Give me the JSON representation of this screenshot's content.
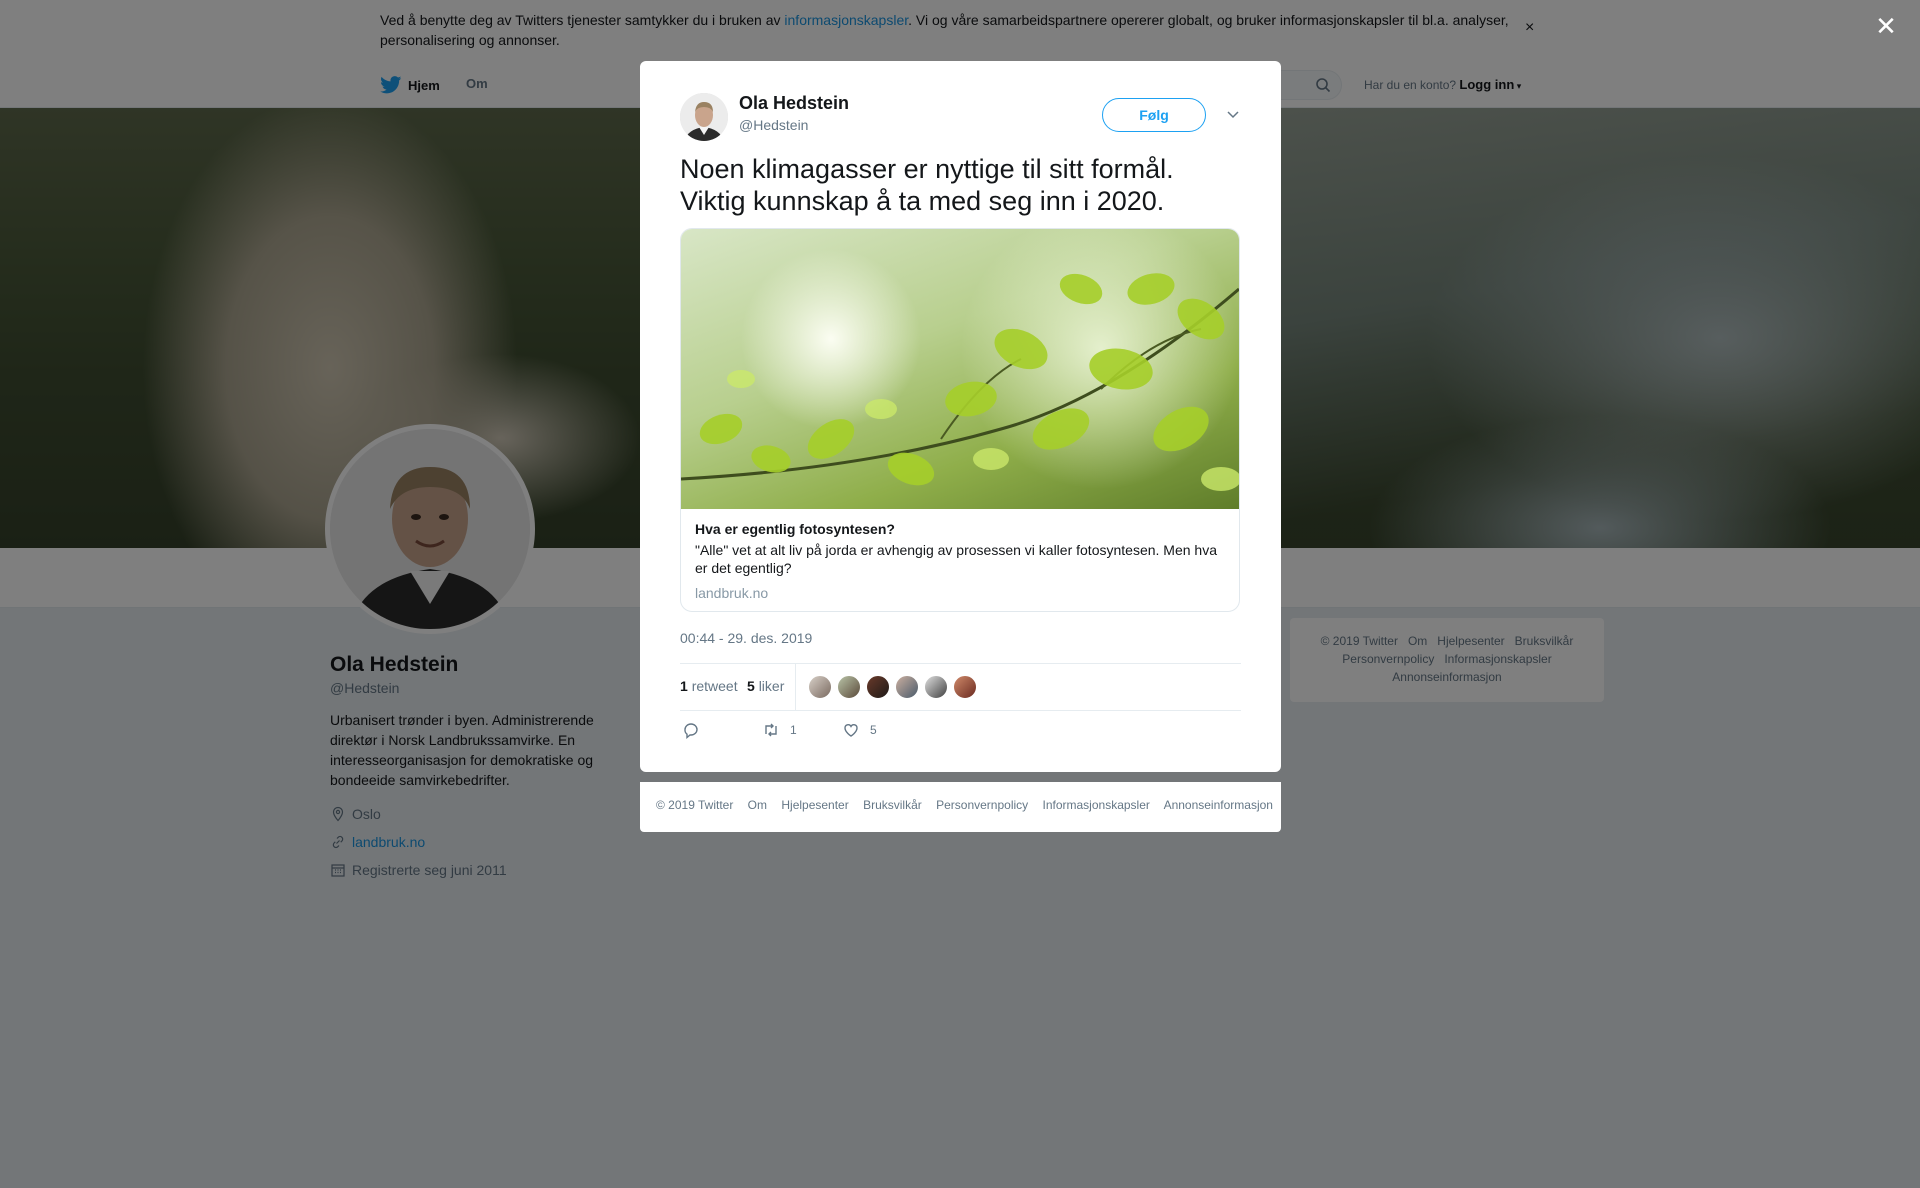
{
  "cookie_bar": {
    "text_before": "Ved å benytte deg av Twitters tjenester samtykker du i bruken av ",
    "link": "informasjonskapsler",
    "text_after": ". Vi og våre samarbeidspartnere opererer globalt, og bruker informasjonskapsler til bl.a. analyser, personalisering og annonser.",
    "close": "×"
  },
  "topnav": {
    "home": "Hjem",
    "about": "Om",
    "login_prompt": "Har du en konto?",
    "login": "Logg inn"
  },
  "profile": {
    "name": "Ola Hedstein",
    "handle": "@Hedstein",
    "bio": "Urbanisert trønder i byen. Administrerende direktør i Norsk Landbrukssamvirke. En interesseorganisasjon for demokratiske og bondeeide samvirkebedrifter.",
    "location": "Oslo",
    "website": "landbruk.no",
    "joined": "Registrerte seg juni 2011"
  },
  "side_footer": {
    "links": [
      "© 2019 Twitter",
      "Om",
      "Hjelpesenter",
      "Bruksvilkår",
      "Personvernpolicy",
      "Informasjonskapsler",
      "Annonseinformasjon"
    ]
  },
  "overlay": {
    "close": "✕"
  },
  "tweet": {
    "author_name": "Ola Hedstein",
    "author_handle": "@Hedstein",
    "follow_label": "Følg",
    "text": "Noen klimagasser er nyttige til sitt formål. Viktig kunnskap å ta med seg inn i 2020.",
    "card": {
      "title": "Hva er egentlig fotosyntesen?",
      "description": "\"Alle\" vet at alt liv på jorda er avhengig av prosessen vi kaller fotosyntesen. Men hva er det egentlig?",
      "domain": "landbruk.no"
    },
    "timestamp": "00:44 - 29. des. 2019",
    "retweet_count": "1",
    "retweet_label": "retweet",
    "like_count": "5",
    "like_label": "liker",
    "action_retweet_count": "1",
    "action_like_count": "5"
  },
  "modal_footer": {
    "links": [
      "© 2019 Twitter",
      "Om",
      "Hjelpesenter",
      "Bruksvilkår",
      "Personvernpolicy",
      "Informasjonskapsler",
      "Annonseinformasjon"
    ]
  },
  "colors": {
    "accent": "#1da1f2",
    "link": "#1b95e0",
    "muted": "#657786",
    "background": "#e6ecf0"
  },
  "icons": {
    "logo": "twitter-bird-icon",
    "search": "search-icon",
    "location": "location-pin-icon",
    "website": "link-icon",
    "calendar": "calendar-icon",
    "reply": "reply-icon",
    "retweet": "retweet-icon",
    "like": "heart-icon",
    "menu": "chevron-down-icon",
    "close": "close-icon"
  }
}
